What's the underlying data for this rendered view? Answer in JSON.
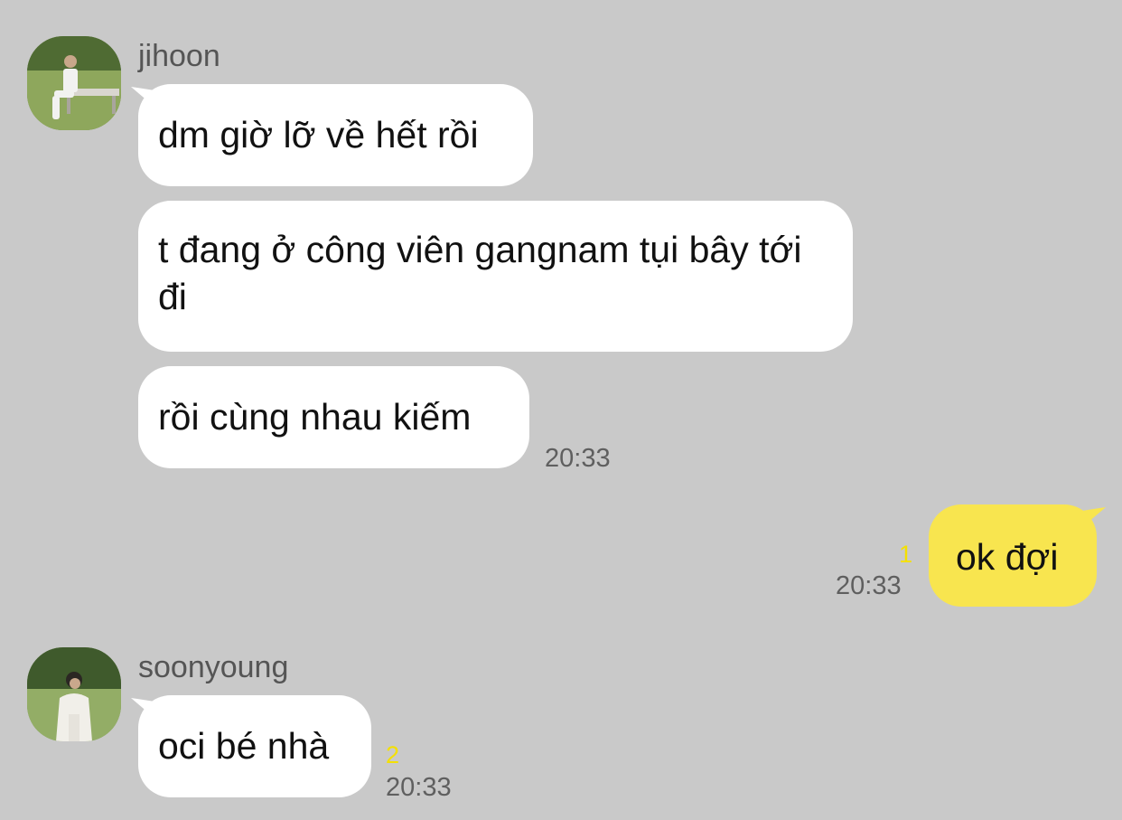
{
  "chat": {
    "colors": {
      "background": "#c9c9c9",
      "incoming_bubble": "#ffffff",
      "outgoing_bubble": "#f8e54f",
      "unread_count": "#f4e000",
      "timestamp": "#5f5f5f"
    },
    "groups": [
      {
        "sender": "jihoon",
        "avatar": "profile-photo-jihoon",
        "messages": [
          {
            "text": "dm giờ lỡ về hết rồi"
          },
          {
            "text": "t đang ở công viên gangnam tụi bây tới đi"
          },
          {
            "text": "rồi cùng nhau kiếm"
          }
        ],
        "time": "20:33"
      },
      {
        "sender": "me",
        "messages": [
          {
            "text": "ok đợi"
          }
        ],
        "unread": "1",
        "time": "20:33"
      },
      {
        "sender": "soonyoung",
        "avatar": "profile-photo-soonyoung",
        "messages": [
          {
            "text": "oci bé nhà"
          }
        ],
        "unread": "2",
        "time": "20:33"
      }
    ]
  }
}
